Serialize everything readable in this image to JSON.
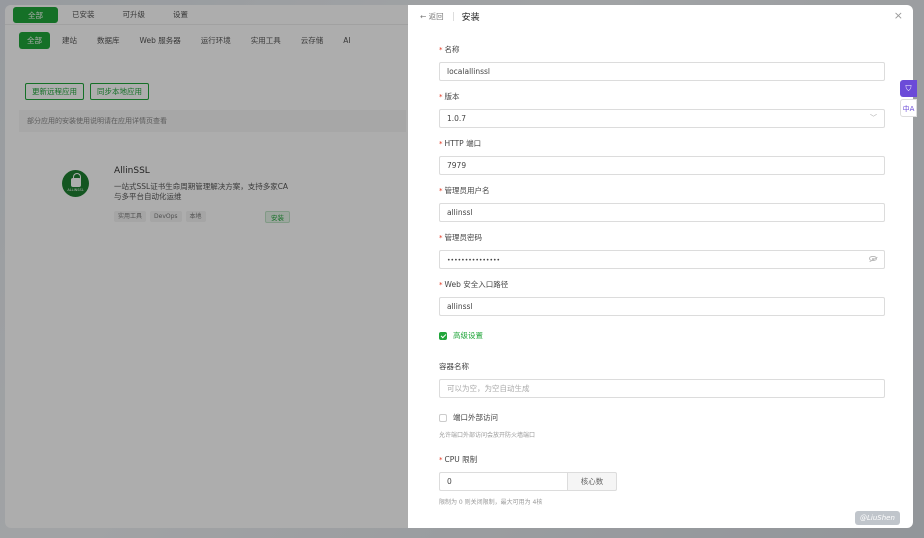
{
  "app": {
    "top_tabs": [
      {
        "label": "全部",
        "active": true
      },
      {
        "label": "已安装",
        "active": false
      },
      {
        "label": "可升级",
        "active": false
      },
      {
        "label": "设置",
        "active": false
      }
    ],
    "categories": [
      {
        "label": "全部",
        "active": true
      },
      {
        "label": "建站",
        "active": false
      },
      {
        "label": "数据库",
        "active": false
      },
      {
        "label": "Web 服务器",
        "active": false
      },
      {
        "label": "运行环境",
        "active": false
      },
      {
        "label": "实用工具",
        "active": false
      },
      {
        "label": "云存储",
        "active": false
      },
      {
        "label": "AI",
        "active": false
      }
    ],
    "actions": {
      "update_remote": "更新远程应用",
      "sync_local": "同步本地应用"
    },
    "notice": "部分应用的安装使用说明请在应用详情页查看",
    "card": {
      "logo_text": "ALLINSSL",
      "name": "AllinSSL",
      "description": "一站式SSL证书生命周期管理解决方案，支持多家CA与多平台自动化运维",
      "tags": [
        "实用工具",
        "DevOps",
        "本地"
      ],
      "install_label": "安装"
    }
  },
  "drawer": {
    "back_label": "← 返回",
    "title": "安装",
    "close_icon": "×",
    "fields": {
      "name": {
        "label": "名称",
        "required": true,
        "value": "localallinssl"
      },
      "version": {
        "label": "版本",
        "required": true,
        "value": "1.0.7",
        "chevron": "﹀"
      },
      "http_port": {
        "label": "HTTP 端口",
        "required": true,
        "value": "7979"
      },
      "admin_user": {
        "label": "管理员用户名",
        "required": true,
        "value": "allinssl"
      },
      "admin_password": {
        "label": "管理员密码",
        "required": true,
        "value": "•••••••••••••••"
      },
      "web_path": {
        "label": "Web 安全入口路径",
        "required": true,
        "value": "allinssl"
      }
    },
    "advanced": {
      "label": "高级设置",
      "checked": true
    },
    "container": {
      "label": "容器名称",
      "placeholder": "可以为空，为空自动生成"
    },
    "external": {
      "label": "端口外部访问",
      "checked": false,
      "hint": "允许端口外部访问会放开防火墙端口"
    },
    "cpu": {
      "label": "CPU 限制",
      "required": true,
      "value": "0",
      "unit": "核心数",
      "hint": "限制为 0 则关闭限制，最大可用为 4核"
    }
  },
  "float": {
    "top": "⛉",
    "bottom": "中A"
  },
  "watermark": "@LiuShen",
  "colors": {
    "accent": "#20a53a",
    "required": "#e2341d",
    "float": "#6b4bd8"
  }
}
